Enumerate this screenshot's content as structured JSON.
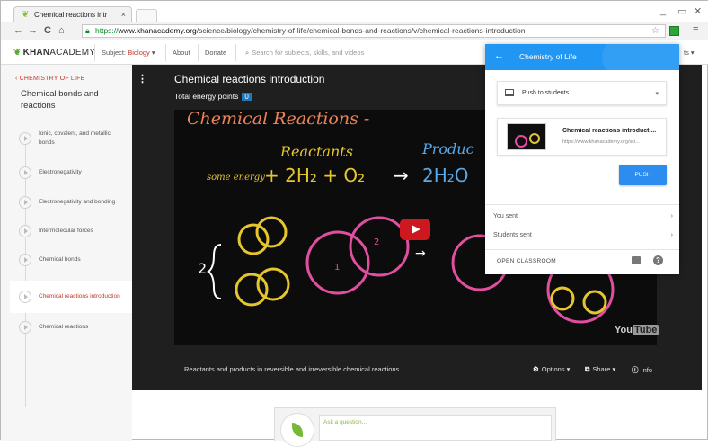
{
  "browser": {
    "tab_title": "Chemical reactions intr",
    "tab_close": "×",
    "min": "_",
    "restore": "▭",
    "close": "✕",
    "back": "←",
    "forward": "→",
    "reload": "C",
    "home": "⌂",
    "url_scheme": "https://",
    "url_host": "www.khanacademy.org",
    "url_path": "/science/biology/chemistry-of-life/chemical-bonds-and-reactions/v/chemical-reactions-introduction",
    "menu": "≡"
  },
  "header": {
    "logo_bold": "KHAN",
    "logo_rest": "ACADEMY",
    "subject_label": "Subject: ",
    "subject_value": "Biology",
    "subject_caret": "▾",
    "about": "About",
    "donate": "Donate",
    "search_placeholder": "Search for subjects, skills, and videos",
    "right_text": "ts ▾"
  },
  "sidebar": {
    "breadcrumb": "‹ CHEMISTRY OF LIFE",
    "topic": "Chemical bonds and reactions",
    "items": [
      {
        "label": "Ionic, covalent, and metallic bonds"
      },
      {
        "label": "Electronegativity"
      },
      {
        "label": "Electronegativity and bonding"
      },
      {
        "label": "Intermolecular forces"
      },
      {
        "label": "Chemical bonds"
      },
      {
        "label": "Chemical reactions introduction"
      },
      {
        "label": "Chemical reactions"
      }
    ]
  },
  "video": {
    "title": "Chemical reactions introduction",
    "energy_label": "Total energy points",
    "energy_points": "0",
    "caption": "Reactants and products in reversible and irreversible chemical reactions.",
    "options": "Options ▾",
    "share": "Share ▾",
    "info": "Info",
    "yt_you": "You",
    "yt_tube": "Tube",
    "board": {
      "heading": "Chemical Reactions -",
      "reactants": "Reactants",
      "products": "Produc",
      "some_energy": "some energy",
      "equation_left": "+ 2H₂ + O₂",
      "arrow": "→",
      "equation_right": "2H₂O",
      "two": "2",
      "one": "1"
    }
  },
  "question": {
    "placeholder": "Ask a question..."
  },
  "popup": {
    "title": "Chemistry of Life",
    "back": "←",
    "push_target": "Push to students",
    "push_caret": "▾",
    "link_title": "Chemical reactions introducti...",
    "link_url": "https://www.khanacademy.org/sci...",
    "push_button": "PUSH",
    "you_sent": "You sent",
    "students_sent": "Students sent",
    "chevron": "›",
    "open_classroom": "OPEN CLASSROOM",
    "help": "?"
  },
  "colors": {
    "accent_blue": "#2196f3",
    "ka_red": "#c0392b",
    "chalk_pink": "#e24ea0",
    "chalk_yellow": "#e6c62e",
    "chalk_blue": "#5aa8e6"
  }
}
